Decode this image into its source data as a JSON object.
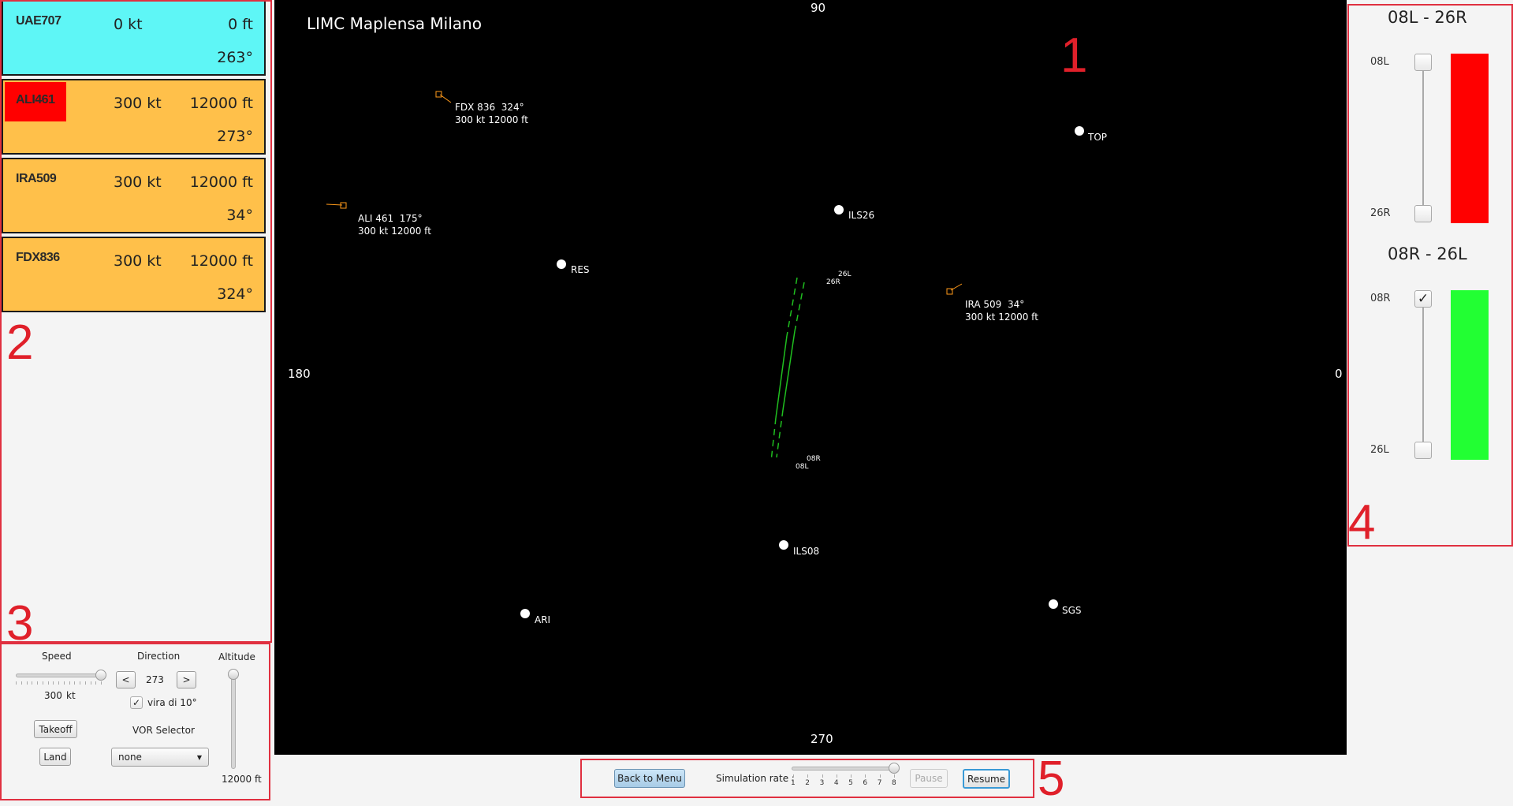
{
  "strips": [
    {
      "callsign": "UAE707",
      "speed": "0 kt",
      "altitude": "0 ft",
      "heading": "263°",
      "color": "#5ef6f6",
      "alert": false
    },
    {
      "callsign": "ALI461",
      "speed": "300 kt",
      "altitude": "12000 ft",
      "heading": "273°",
      "color": "#ffc04a",
      "alert": true
    },
    {
      "callsign": "IRA509",
      "speed": "300 kt",
      "altitude": "12000 ft",
      "heading": "34°",
      "color": "#ffc04a",
      "alert": false
    },
    {
      "callsign": "FDX836",
      "speed": "300 kt",
      "altitude": "12000 ft",
      "heading": "324°",
      "color": "#ffc04a",
      "alert": false
    }
  ],
  "radar": {
    "title": "LIMC Maplensa Milano",
    "compass": {
      "north": "90",
      "south": "270",
      "west": "180",
      "east": "0"
    },
    "vors": {
      "top": "TOP",
      "ils26": "ILS26",
      "res": "RES",
      "ils08": "ILS08",
      "ari": "ARI",
      "sgs": "SGS"
    },
    "runways": {
      "r26l": "26L",
      "r26r": "26R",
      "r08r": "08R",
      "r08l": "08L"
    },
    "planes": {
      "fdx": {
        "line1": "FDX 836  324°",
        "line2": "300 kt 12000 ft"
      },
      "ali": {
        "line1": "ALI 461  175°",
        "line2": "300 kt 12000 ft"
      },
      "ira": {
        "line1": "IRA 509  34°",
        "line2": "300 kt 12000 ft"
      }
    },
    "plane_color": "#ff9a1a"
  },
  "controls": {
    "speed_label": "Speed",
    "speed_value": "300",
    "speed_unit": "kt",
    "speed_fraction": 1.0,
    "direction_label": "Direction",
    "direction_value": "273",
    "dir_left": "<",
    "dir_right": ">",
    "turn_label": "vira di 10°",
    "turn_checked": "✓",
    "altitude_label": "Altitude",
    "altitude_value": "12000 ft",
    "altitude_fraction": 1.0,
    "takeoff": "Takeoff",
    "land": "Land",
    "vor_label": "VOR Selector",
    "vor_selected": "none"
  },
  "runway_panel": {
    "pair1": {
      "title": "08L - 26R",
      "top": "08L",
      "bottom": "26R",
      "top_checked": false,
      "status_color": "#ff0000"
    },
    "pair2": {
      "title": "08R - 26L",
      "top": "08R",
      "bottom": "26L",
      "top_checked": true,
      "check": "✓",
      "status_color": "#22ff33"
    }
  },
  "bottom_bar": {
    "back": "Back to Menu",
    "rate_label": "Simulation rate :",
    "ticks": [
      "1",
      "2",
      "3",
      "4",
      "5",
      "6",
      "7",
      "8"
    ],
    "rate_value": 8,
    "pause": "Pause",
    "resume": "Resume"
  },
  "area_labels": [
    "1",
    "2",
    "3",
    "4",
    "5"
  ]
}
